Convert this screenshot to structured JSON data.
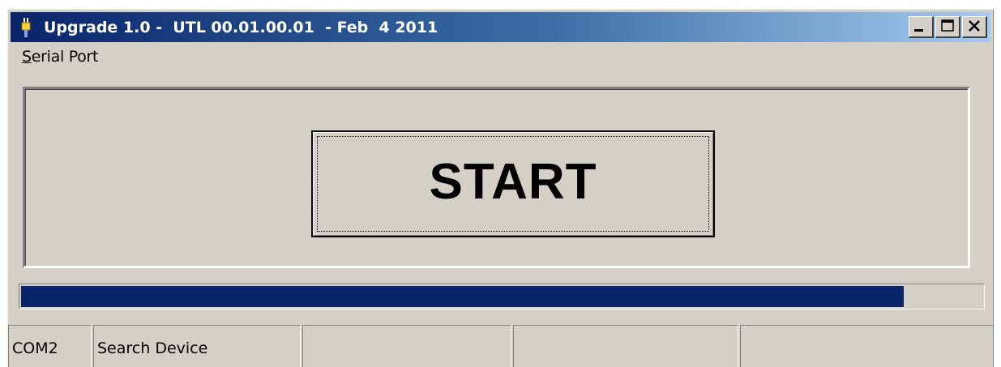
{
  "window": {
    "title": "Upgrade 1.0 -  UTL 00.01.00.01  - Feb  4 2011",
    "app_icon": "usb-plug-icon",
    "controls": [
      {
        "name": "minimize-icon"
      },
      {
        "name": "maximize-icon"
      },
      {
        "name": "close-icon"
      }
    ]
  },
  "menu": {
    "items": [
      {
        "hotkey": "S",
        "rest": "erial Port"
      }
    ]
  },
  "main": {
    "start_label": "START"
  },
  "progress": {
    "value_percent": 91.8,
    "color": "#0a246a"
  },
  "statusbar": {
    "cells": [
      "COM2",
      "Search Device",
      "",
      "",
      ""
    ]
  },
  "colors": {
    "face": "#d4d0c8",
    "title_start": "#0a246a",
    "title_end": "#a6caf0"
  }
}
